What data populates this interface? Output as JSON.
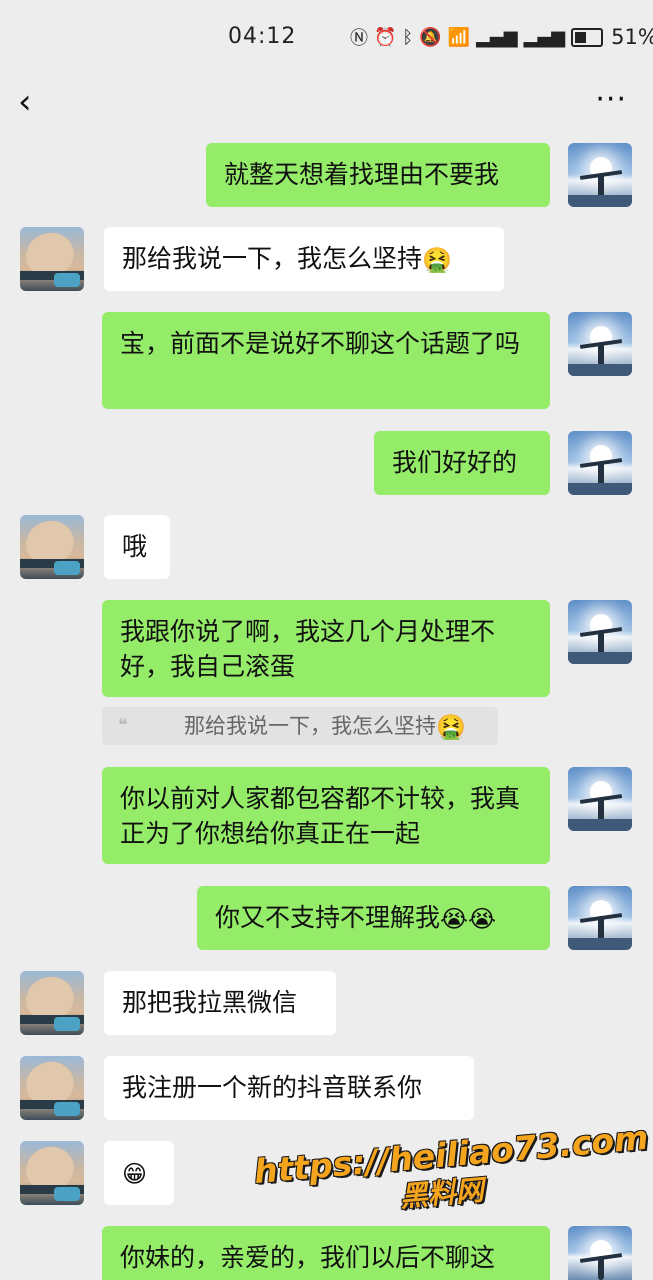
{
  "status_bar": {
    "time": "04:12",
    "icons": [
      "nfc-icon",
      "alarm-icon",
      "bluetooth-icon",
      "mute-icon",
      "wifi-icon",
      "signal-5g-icon",
      "signal-4g-icon"
    ],
    "battery": "51%"
  },
  "nav": {
    "back_symbol": "‹",
    "more_symbol": "···"
  },
  "messages": [
    {
      "side": "right",
      "text": "就整天想着找理由不要我"
    },
    {
      "side": "left",
      "text": "那给我说一下，我怎么坚持",
      "emoji": "🤮"
    },
    {
      "side": "right",
      "text": "宝，前面不是说好不聊这个话题了吗"
    },
    {
      "side": "right",
      "text": "我们好好的"
    },
    {
      "side": "left",
      "text": "哦"
    },
    {
      "side": "right",
      "text": "我跟你说了啊，我这几个月处理不好，我自己滚蛋"
    },
    {
      "side": "right",
      "text": "你以前对人家都包容都不计较，我真正为了你想给你真正在一起"
    },
    {
      "side": "right",
      "text": "你又不支持不理解我",
      "emoji": "😭😭"
    },
    {
      "side": "left",
      "text": "那把我拉黑微信"
    },
    {
      "side": "left",
      "text": "我注册一个新的抖音联系你"
    },
    {
      "side": "left",
      "text": "",
      "emoji": "😁"
    },
    {
      "side": "right",
      "text": "你妹的，亲爱的，我们以后不聊这"
    }
  ],
  "quote": {
    "text": "那给我说一下，我怎么坚持",
    "emoji": "🤮"
  },
  "watermark": {
    "url": "https://heiliao73.com",
    "name": "黑料网"
  },
  "colors": {
    "background": "#ededed",
    "sent_bubble": "#95ec69",
    "received_bubble": "#ffffff",
    "watermark": "#f5a41e"
  }
}
